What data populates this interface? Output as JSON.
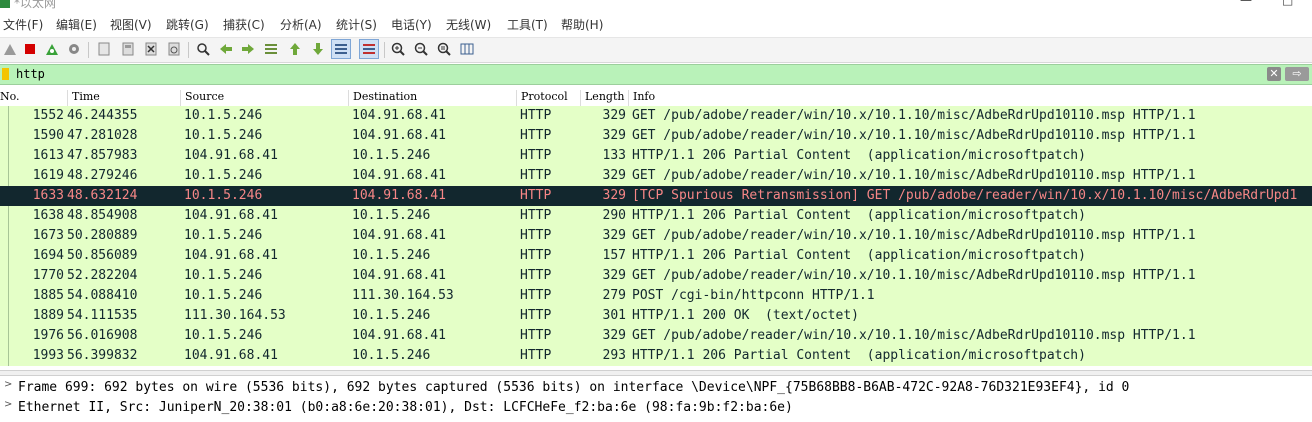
{
  "window": {
    "title": "*以太网"
  },
  "menu": [
    "文件(F)",
    "编辑(E)",
    "视图(V)",
    "跳转(G)",
    "捕获(C)",
    "分析(A)",
    "统计(S)",
    "电话(Y)",
    "无线(W)",
    "工具(T)",
    "帮助(H)"
  ],
  "toolbar": {
    "icons": [
      "shark-fin-start-icon",
      "stop-capture-icon",
      "restart-capture-icon",
      "capture-options-icon",
      "open-file-icon",
      "save-file-icon",
      "close-file-icon",
      "reload-icon",
      "find-packet-icon",
      "go-back-icon",
      "go-forward-icon",
      "go-to-packet-icon",
      "go-first-icon",
      "go-last-icon",
      "auto-scroll-icon",
      "colorize-icon",
      "zoom-in-icon",
      "zoom-out-icon",
      "zoom-normal-icon",
      "resize-columns-icon"
    ]
  },
  "filter": {
    "value": "http"
  },
  "columns": {
    "no": "No.",
    "time": "Time",
    "source": "Source",
    "destination": "Destination",
    "protocol": "Protocol",
    "length": "Length",
    "info": "Info"
  },
  "packets": [
    {
      "no": "1552",
      "time": "46.244355",
      "src": "10.1.5.246",
      "dst": "104.91.68.41",
      "proto": "HTTP",
      "len": "329",
      "info": "GET /pub/adobe/reader/win/10.x/10.1.10/misc/AdbeRdrUpd10110.msp HTTP/1.1"
    },
    {
      "no": "1590",
      "time": "47.281028",
      "src": "10.1.5.246",
      "dst": "104.91.68.41",
      "proto": "HTTP",
      "len": "329",
      "info": "GET /pub/adobe/reader/win/10.x/10.1.10/misc/AdbeRdrUpd10110.msp HTTP/1.1"
    },
    {
      "no": "1613",
      "time": "47.857983",
      "src": "104.91.68.41",
      "dst": "10.1.5.246",
      "proto": "HTTP",
      "len": "133",
      "info": "HTTP/1.1 206 Partial Content  (application/microsoftpatch)"
    },
    {
      "no": "1619",
      "time": "48.279246",
      "src": "10.1.5.246",
      "dst": "104.91.68.41",
      "proto": "HTTP",
      "len": "329",
      "info": "GET /pub/adobe/reader/win/10.x/10.1.10/misc/AdbeRdrUpd10110.msp HTTP/1.1"
    },
    {
      "no": "1633",
      "time": "48.632124",
      "src": "10.1.5.246",
      "dst": "104.91.68.41",
      "proto": "HTTP",
      "len": "329",
      "info": "[TCP Spurious Retransmission] GET /pub/adobe/reader/win/10.x/10.1.10/misc/AdbeRdrUpd1",
      "selected": true
    },
    {
      "no": "1638",
      "time": "48.854908",
      "src": "104.91.68.41",
      "dst": "10.1.5.246",
      "proto": "HTTP",
      "len": "290",
      "info": "HTTP/1.1 206 Partial Content  (application/microsoftpatch)"
    },
    {
      "no": "1673",
      "time": "50.280889",
      "src": "10.1.5.246",
      "dst": "104.91.68.41",
      "proto": "HTTP",
      "len": "329",
      "info": "GET /pub/adobe/reader/win/10.x/10.1.10/misc/AdbeRdrUpd10110.msp HTTP/1.1"
    },
    {
      "no": "1694",
      "time": "50.856089",
      "src": "104.91.68.41",
      "dst": "10.1.5.246",
      "proto": "HTTP",
      "len": "157",
      "info": "HTTP/1.1 206 Partial Content  (application/microsoftpatch)"
    },
    {
      "no": "1770",
      "time": "52.282204",
      "src": "10.1.5.246",
      "dst": "104.91.68.41",
      "proto": "HTTP",
      "len": "329",
      "info": "GET /pub/adobe/reader/win/10.x/10.1.10/misc/AdbeRdrUpd10110.msp HTTP/1.1"
    },
    {
      "no": "1885",
      "time": "54.088410",
      "src": "10.1.5.246",
      "dst": "111.30.164.53",
      "proto": "HTTP",
      "len": "279",
      "info": "POST /cgi-bin/httpconn HTTP/1.1"
    },
    {
      "no": "1889",
      "time": "54.111535",
      "src": "111.30.164.53",
      "dst": "10.1.5.246",
      "proto": "HTTP",
      "len": "301",
      "info": "HTTP/1.1 200 OK  (text/octet)"
    },
    {
      "no": "1976",
      "time": "56.016908",
      "src": "10.1.5.246",
      "dst": "104.91.68.41",
      "proto": "HTTP",
      "len": "329",
      "info": "GET /pub/adobe/reader/win/10.x/10.1.10/misc/AdbeRdrUpd10110.msp HTTP/1.1"
    },
    {
      "no": "1993",
      "time": "56.399832",
      "src": "104.91.68.41",
      "dst": "10.1.5.246",
      "proto": "HTTP",
      "len": "293",
      "info": "HTTP/1.1 206 Partial Content  (application/microsoftpatch)"
    }
  ],
  "details": [
    "Frame 699: 692 bytes on wire (5536 bits), 692 bytes captured (5536 bits) on interface \\Device\\NPF_{75B68BB8-B6AB-472C-92A8-76D321E93EF4}, id 0",
    "Ethernet II, Src: JuniperN_20:38:01 (b0:a8:6e:20:38:01), Dst: LCFCHeFe_f2:ba:6e (98:fa:9b:f2:ba:6e)"
  ],
  "colors": {
    "http_row_bg": "#e4ffc7",
    "selected_bg": "#12272e",
    "selected_fg": "#f78787",
    "filter_bg": "#b9f2b9"
  }
}
